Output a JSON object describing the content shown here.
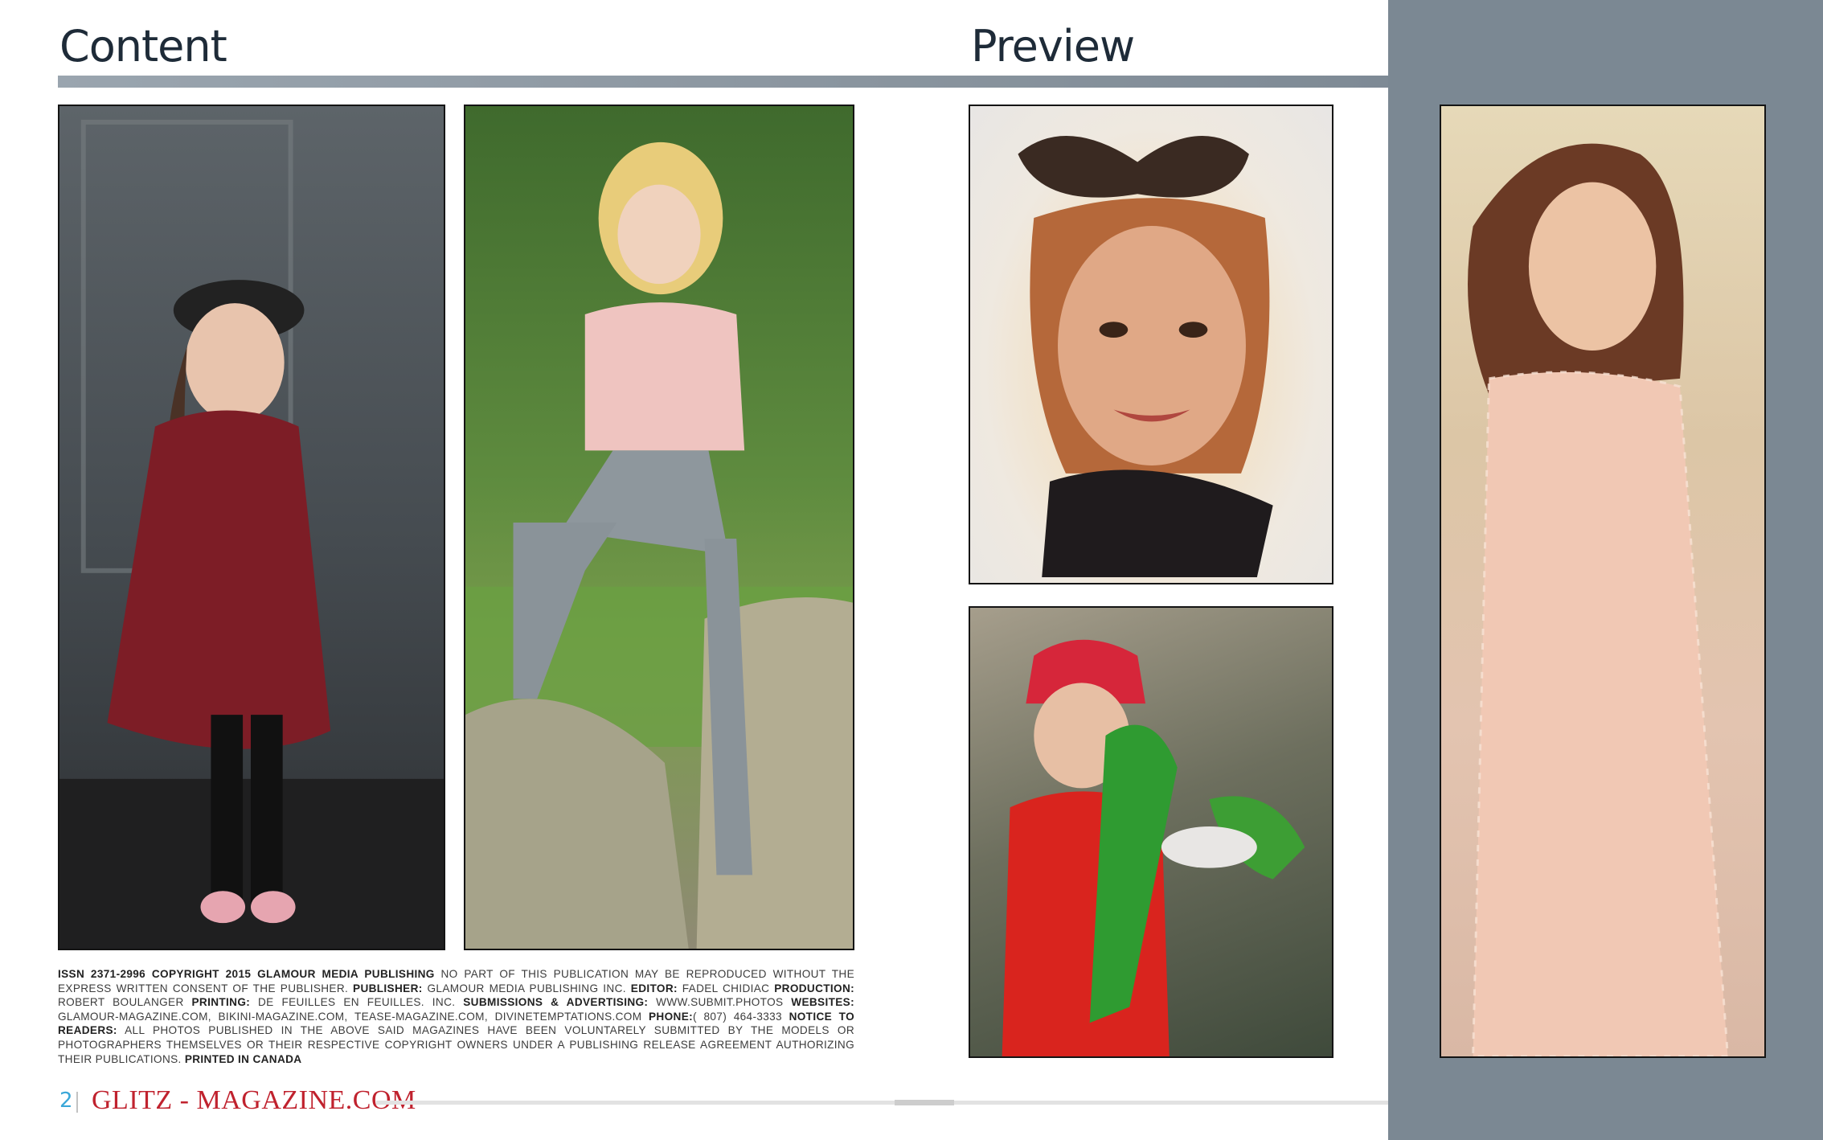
{
  "headings": {
    "content": "Content",
    "preview": "Preview"
  },
  "credits": {
    "issn": "ISSN 2371-2996 COPYRIGHT 2015 GLAMOUR MEDIA PUBLISHING",
    "notice": " NO PART OF THIS PUBLICATION MAY BE REPRODUCED WITHOUT THE EXPRESS WRITTEN CONSENT OF THE PUBLISHER. ",
    "publisher_label": "PUBLISHER:",
    "publisher": " GLAMOUR MEDIA PUBLISHING INC. ",
    "editor_label": "EDITOR:",
    "editor": " FADEL CHIDIAC ",
    "production_label": "PRODUCTION:",
    "production": " ROBERT BOULANGER ",
    "printing_label": "PRINTING:",
    "printing": " DE FEUILLES EN FEUILLES. INC. ",
    "submissions_label": "SUBMISSIONS & ADVERTISING:",
    "submissions": " WWW.SUBMIT.PHOTOS ",
    "websites_label": "WEBSITES:",
    "websites": " GLAMOUR-MAGAZINE.COM, BIKINI-MAGAZINE.COM, TEASE-MAGAZINE.COM, DIVINETEMPTATIONS.COM ",
    "phone_label": "PHONE:",
    "phone": "( 807) 464-3333 ",
    "readers_label": "NOTICE TO READERS:",
    "readers": " ALL PHOTOS PUBLISHED IN THE ABOVE SAID MAGAZINES HAVE BEEN VOLUNTARELY SUBMITTED BY THE MODELS OR PHOTOGRAPHERS THEMSELVES OR THEIR RESPECTIVE COPYRIGHT OWNERS UNDER A PUBLISHING RELEASE AGREEMENT AUTHORIZING THEIR PUBLICATIONS. ",
    "printed": "PRINTED IN CANADA"
  },
  "footer": {
    "page_number": "2",
    "brand": "GLITZ - MAGAZINE.COM"
  },
  "colors": {
    "side_panel": "#7b8893",
    "heading": "#1e2b38",
    "brand_red": "#c0222e",
    "page_number_blue": "#3aa7d8"
  }
}
